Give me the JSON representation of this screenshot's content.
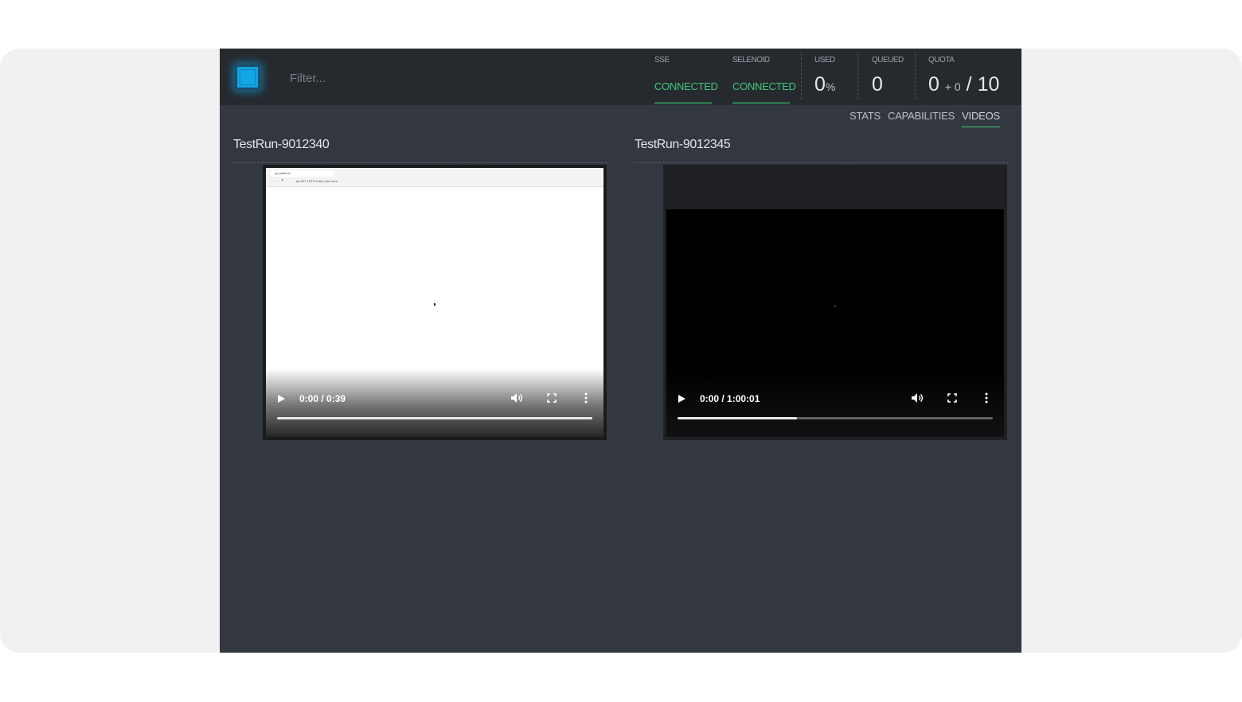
{
  "header": {
    "filter_placeholder": "Filter...",
    "logo_icon": "selenoid-logo-icon",
    "stats": {
      "sse": {
        "label": "SSE",
        "status": "CONNECTED"
      },
      "selenoid": {
        "label": "SELENOID",
        "status": "CONNECTED"
      },
      "used": {
        "label": "USED",
        "value": "0",
        "unit": "%"
      },
      "queued": {
        "label": "QUEUED",
        "value": "0"
      },
      "quota": {
        "label": "QUOTA",
        "value": "0",
        "extra": "+ 0",
        "total": "/ 10"
      }
    }
  },
  "tabs": [
    {
      "label": "STATS",
      "active": false
    },
    {
      "label": "CAPABILITIES",
      "active": false
    },
    {
      "label": "VIDEOS",
      "active": true
    }
  ],
  "videos": [
    {
      "title": "TestRun-9012340",
      "time": "0:00 / 0:39",
      "progress": 1.0,
      "browser_tab": "qa-platform",
      "browser_url": "tpl-607-129124.dbp.inno.tech"
    },
    {
      "title": "TestRun-9012345",
      "time": "0:00 / 1:00:01",
      "progress": 0.38
    }
  ],
  "colors": {
    "accent_green": "#3fc77a",
    "logo_blue": "#13a2e0",
    "background": "#333840",
    "topbar": "#262a2f"
  },
  "icons": {
    "play": "play-icon",
    "volume": "volume-icon",
    "fullscreen": "fullscreen-icon",
    "more": "more-vertical-icon"
  }
}
